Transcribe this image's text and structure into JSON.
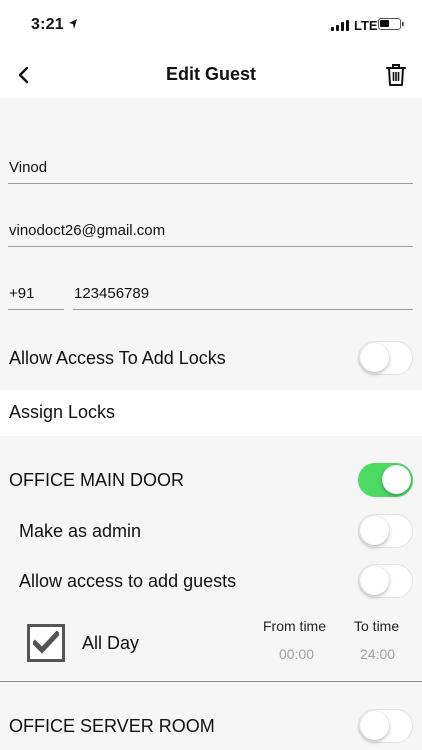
{
  "status_bar": {
    "time": "3:21",
    "carrier": "LTE"
  },
  "nav": {
    "title": "Edit Guest",
    "back_icon": "chevron-left-icon",
    "delete_icon": "trash-icon"
  },
  "form": {
    "name": "Vinod",
    "email": "vinodoct26@gmail.com",
    "country_code": "+91",
    "phone": "123456789"
  },
  "allow_add_locks": {
    "label": "Allow Access To Add Locks",
    "on": false
  },
  "assign_locks_title": "Assign Locks",
  "locks": [
    {
      "name": "OFFICE MAIN DOOR",
      "on": true,
      "make_admin": {
        "label": "Make as admin",
        "on": false
      },
      "allow_add_guests": {
        "label": "Allow access to add guests",
        "on": false
      },
      "all_day": {
        "label": "All Day",
        "checked": true
      },
      "from_time": {
        "label": "From time",
        "value": "00:00"
      },
      "to_time": {
        "label": "To time",
        "value": "24:00"
      }
    },
    {
      "name": "OFFICE SERVER ROOM",
      "on": false
    }
  ],
  "colors": {
    "accent_on": "#4cd964",
    "divider": "#9a9aa8",
    "muted_time": "#a0a0a8"
  }
}
